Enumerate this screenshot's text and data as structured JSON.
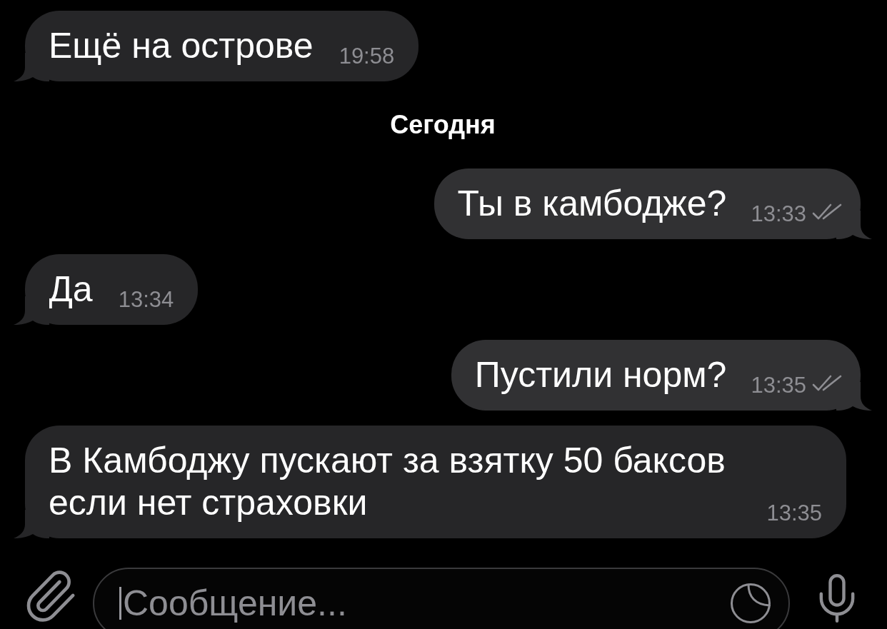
{
  "feed": [
    {
      "kind": "message",
      "outgoing": false,
      "text": "Ещё на острове",
      "time": "19:58"
    },
    {
      "kind": "date",
      "label": "Сегодня"
    },
    {
      "kind": "message",
      "outgoing": true,
      "text": "Ты в камбодже?",
      "time": "13:33",
      "read": true
    },
    {
      "kind": "message",
      "outgoing": false,
      "text": "Да",
      "time": "13:34"
    },
    {
      "kind": "message",
      "outgoing": true,
      "text": "Пустили норм?",
      "time": "13:35",
      "read": true
    },
    {
      "kind": "message",
      "outgoing": false,
      "text": "В Камбоджу пускают за взятку 50 баксов если нет страховки",
      "time": "13:35"
    }
  ],
  "composer": {
    "placeholder": "Сообщение..."
  }
}
